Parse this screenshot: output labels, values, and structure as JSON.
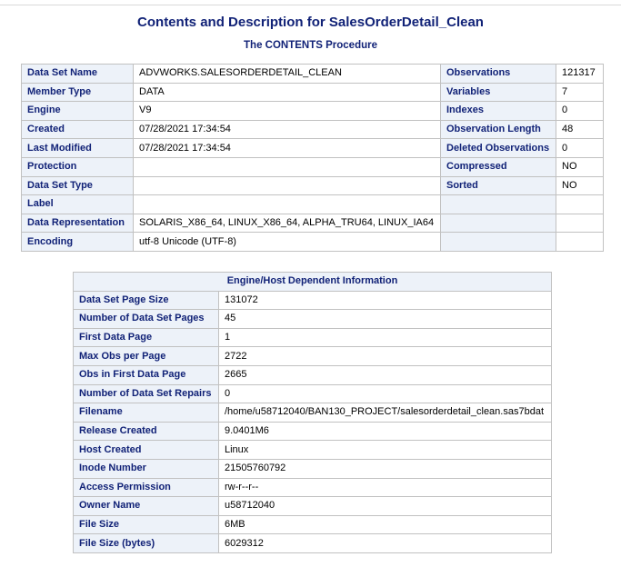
{
  "title": "Contents and Description for SalesOrderDetail_Clean",
  "subtitle": "The CONTENTS Procedure",
  "attributes": {
    "rows": [
      {
        "l1": "Data Set Name",
        "v1": "ADVWORKS.SALESORDERDETAIL_CLEAN",
        "l2": "Observations",
        "v2": "121317"
      },
      {
        "l1": "Member Type",
        "v1": "DATA",
        "l2": "Variables",
        "v2": "7"
      },
      {
        "l1": "Engine",
        "v1": "V9",
        "l2": "Indexes",
        "v2": "0"
      },
      {
        "l1": "Created",
        "v1": "07/28/2021 17:34:54",
        "l2": "Observation Length",
        "v2": "48"
      },
      {
        "l1": "Last Modified",
        "v1": "07/28/2021 17:34:54",
        "l2": "Deleted Observations",
        "v2": "0"
      },
      {
        "l1": "Protection",
        "v1": "",
        "l2": "Compressed",
        "v2": "NO"
      },
      {
        "l1": "Data Set Type",
        "v1": "",
        "l2": "Sorted",
        "v2": "NO"
      },
      {
        "l1": "Label",
        "v1": "",
        "l2": "",
        "v2": ""
      },
      {
        "l1": "Data Representation",
        "v1": "SOLARIS_X86_64, LINUX_X86_64, ALPHA_TRU64, LINUX_IA64",
        "l2": "",
        "v2": ""
      },
      {
        "l1": "Encoding",
        "v1": "utf-8 Unicode (UTF-8)",
        "l2": "",
        "v2": ""
      }
    ]
  },
  "engine": {
    "header": "Engine/Host Dependent Information",
    "rows": [
      {
        "label": "Data Set Page Size",
        "value": "131072"
      },
      {
        "label": "Number of Data Set Pages",
        "value": "45"
      },
      {
        "label": "First Data Page",
        "value": "1"
      },
      {
        "label": "Max Obs per Page",
        "value": "2722"
      },
      {
        "label": "Obs in First Data Page",
        "value": "2665"
      },
      {
        "label": "Number of Data Set Repairs",
        "value": "0"
      },
      {
        "label": "Filename",
        "value": "/home/u58712040/BAN130_PROJECT/salesorderdetail_clean.sas7bdat"
      },
      {
        "label": "Release Created",
        "value": "9.0401M6"
      },
      {
        "label": "Host Created",
        "value": "Linux"
      },
      {
        "label": "Inode Number",
        "value": "21505760792"
      },
      {
        "label": "Access Permission",
        "value": "rw-r--r--"
      },
      {
        "label": "Owner Name",
        "value": "u58712040"
      },
      {
        "label": "File Size",
        "value": "6MB"
      },
      {
        "label": "File Size (bytes)",
        "value": "6029312"
      }
    ]
  },
  "colors": {
    "header_bg": "#edf2f9",
    "header_text": "#112277",
    "border": "#c1c1c1"
  }
}
